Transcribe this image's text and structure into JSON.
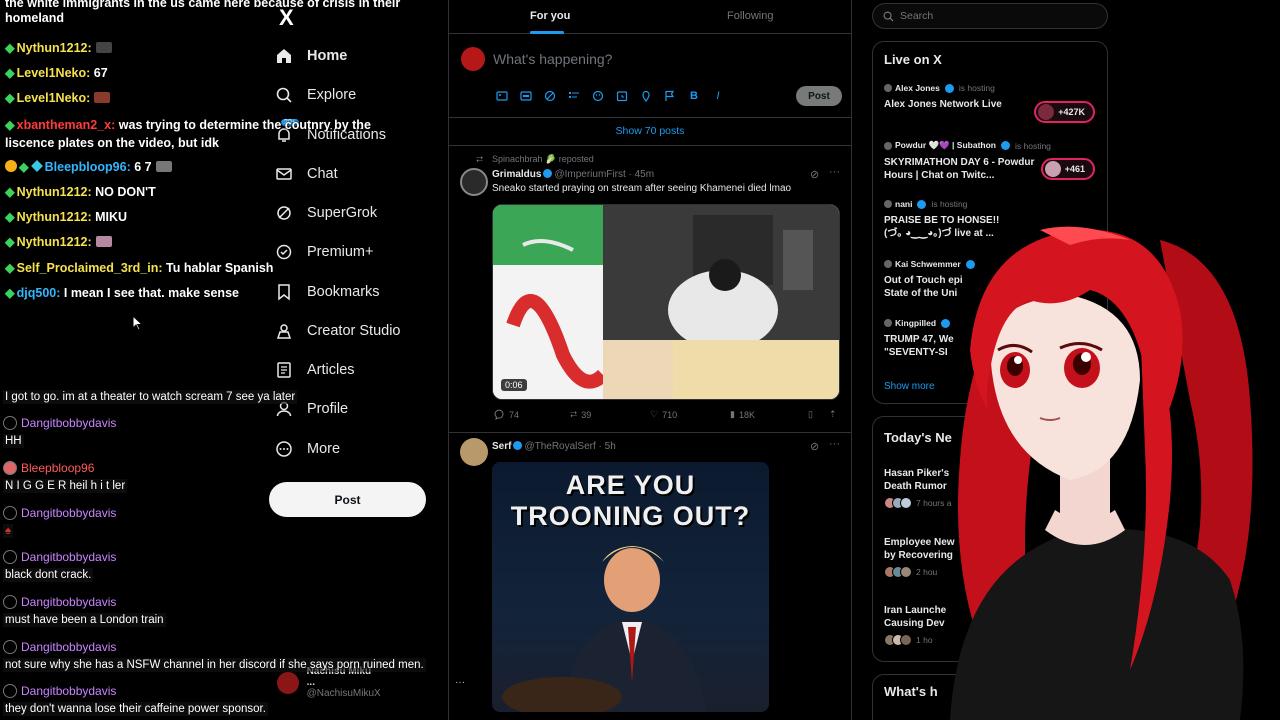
{
  "chat": {
    "top_partial": "the white immigrants in the us came here because of crisis in their homeland",
    "messages": [
      {
        "user": "Nythun1212:",
        "text": ""
      },
      {
        "user": "Level1Neko:",
        "text": "67"
      },
      {
        "user": "Level1Neko:",
        "text": ""
      },
      {
        "user": "xbantheman2_x:",
        "text": "was trying to determine the coutnry by the liscence plates on the video, but idk"
      },
      {
        "user": "Bleepbloop96:",
        "text": "6 7"
      },
      {
        "user": "Nythun1212:",
        "text": "NO DON'T"
      },
      {
        "user": "Nythun1212:",
        "text": "MIKU"
      },
      {
        "user": "Nythun1212:",
        "text": ""
      },
      {
        "user": "Self_Proclaimed_3rd_in:",
        "text": "Tu hablar Spanish"
      },
      {
        "user": "djq500:",
        "text": "I mean I see that. make sense"
      }
    ]
  },
  "chat2": {
    "intro": "I got to go. im at a theater to watch scream 7 see ya later",
    "messages": [
      {
        "user": "Dangitbobbydavis",
        "text": "HH"
      },
      {
        "user": "Bleepbloop96",
        "text": "N I G G E R heil h i t ler"
      },
      {
        "user": "Dangitbobbydavis",
        "text": ""
      },
      {
        "user": "Dangitbobbydavis",
        "text": "black dont crack."
      },
      {
        "user": "Dangitbobbydavis",
        "text": "must have been a London train"
      },
      {
        "user": "Dangitbobbydavis",
        "text": "not sure why she has a NSFW channel in her discord if she says porn ruined men."
      },
      {
        "user": "Dangitbobbydavis",
        "text": "they don't wanna lose their caffeine power sponsor."
      }
    ]
  },
  "nav": {
    "logo": "X",
    "items": [
      "Home",
      "Explore",
      "Notifications",
      "Chat",
      "SuperGrok",
      "Premium+",
      "Bookmarks",
      "Creator Studio",
      "Articles",
      "Profile",
      "More"
    ],
    "notif_badge": "20+",
    "post_label": "Post",
    "account": {
      "name": "Nachisu Miku ...",
      "handle": "@NachisuMikuX"
    }
  },
  "timeline": {
    "tabs": [
      "For you",
      "Following"
    ],
    "composer_placeholder": "What's happening?",
    "composer_post": "Post",
    "show_posts": "Show 70 posts",
    "tweet1": {
      "reposted_by": "Spinachbrah 🥬 reposted",
      "name": "Grimaldus",
      "handle": "@ImperiumFirst",
      "time": "· 45m",
      "text": "Sneako started praying on stream after seeing Khamenei died lmao",
      "duration": "0:06",
      "replies": "74",
      "reposts": "39",
      "likes": "710",
      "views": "18K"
    },
    "tweet2": {
      "name": "Serf",
      "handle": "@TheRoyalSerf",
      "time": "· 5h",
      "image_headline_1": "ARE YOU",
      "image_headline_2": "TROONING OUT?"
    }
  },
  "right": {
    "search_placeholder": "Search",
    "live_title": "Live on X",
    "live": [
      {
        "host": "Alex Jones",
        "status": "is hosting",
        "title": "Alex Jones Network Live",
        "count": "+427K"
      },
      {
        "host": "Powdur 🤍💜 | Subathon",
        "status": "is hosting",
        "title": "SKYRIMATHON DAY 6 - Powdur Hours | Chat on Twitc...",
        "count": "+461"
      },
      {
        "host": "nani",
        "status": "is hosting",
        "title": "PRAISE BE TO HONSE!! (づ｡ ◕‿‿◕｡)づ live at ...",
        "count": ""
      },
      {
        "host": "Kai Schwemmer",
        "status": "",
        "title": "Out of Touch epi State of the Uni",
        "count": ""
      },
      {
        "host": "Kingpilled",
        "status": "",
        "title": "TRUMP 47, We \"SEVENTY-SI",
        "count": ""
      }
    ],
    "show_more": "Show more",
    "news_title": "Today's Ne",
    "news": [
      {
        "title": "Hasan Piker's Death Rumor",
        "meta": "7 hours a"
      },
      {
        "title": "Employee New by Recovering",
        "meta": "2 hou"
      },
      {
        "title": "Iran Launche Causing Dev",
        "meta": "1 ho"
      }
    ],
    "whats_title": "What's h"
  },
  "colors": {
    "accent": "#1d9bf0",
    "chat_green": "#3bd25d",
    "chat_yellow": "#f6e24c",
    "chat_red": "#ff3b3b",
    "chat_purple": "#c984ff",
    "live_pill": "#e0245e"
  }
}
